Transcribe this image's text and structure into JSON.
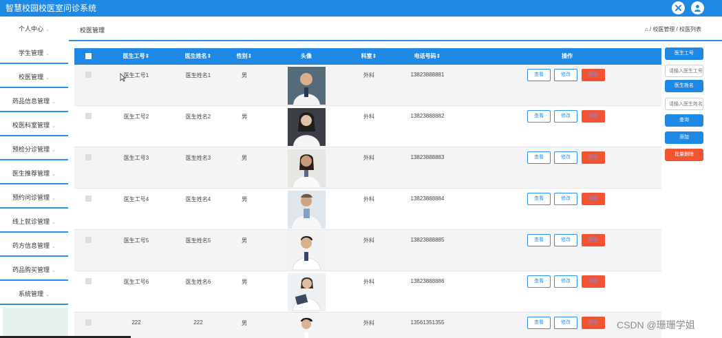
{
  "app": {
    "title": "智慧校园校医室问诊系统"
  },
  "colors": {
    "primary": "#1e88e5",
    "danger": "#f4532f",
    "sidebar_bottom": "#e6f2ec"
  },
  "topbar_icons": [
    "close-circle-icon",
    "user-icon"
  ],
  "sidebar": {
    "user_label": "个人中心",
    "items": [
      {
        "label": "学生管理"
      },
      {
        "label": "校医管理"
      },
      {
        "label": "药品信息管理"
      },
      {
        "label": "校医科室管理"
      },
      {
        "label": "预检分诊管理"
      },
      {
        "label": "医生推荐管理"
      },
      {
        "label": "预约问诊管理"
      },
      {
        "label": "线上就诊管理"
      },
      {
        "label": "药方信息管理"
      },
      {
        "label": "药品购买管理"
      },
      {
        "label": "系统管理"
      }
    ],
    "chevron": "⌄"
  },
  "breadcrumb": {
    "title": "校医管理",
    "path": "⌂ / 校医管理 / 校医列表"
  },
  "table": {
    "columns": [
      "医生工号⇕",
      "医生姓名⇕",
      "性别⇕",
      "头像",
      "科室⇕",
      "电话号码⇕",
      "操作"
    ],
    "rows": [
      {
        "id": "医生工号1",
        "name": "医生姓名1",
        "gender": "男",
        "dept": "外科",
        "phone": "13823888881",
        "avatar": "doctor-photo-icon"
      },
      {
        "id": "医生工号2",
        "name": "医生姓名2",
        "gender": "男",
        "dept": "外科",
        "phone": "13823888882",
        "avatar": "doctor-photo-icon"
      },
      {
        "id": "医生工号3",
        "name": "医生姓名3",
        "gender": "男",
        "dept": "外科",
        "phone": "13823888883",
        "avatar": "doctor-photo-icon"
      },
      {
        "id": "医生工号4",
        "name": "医生姓名4",
        "gender": "男",
        "dept": "外科",
        "phone": "13823888884",
        "avatar": "doctor-photo-icon"
      },
      {
        "id": "医生工号5",
        "name": "医生姓名5",
        "gender": "男",
        "dept": "外科",
        "phone": "13823888885",
        "avatar": "doctor-photo-icon"
      },
      {
        "id": "医生工号6",
        "name": "医生姓名6",
        "gender": "男",
        "dept": "外科",
        "phone": "13823888886",
        "avatar": "doctor-photo-icon"
      },
      {
        "id": "222",
        "name": "222",
        "gender": "男",
        "dept": "外科",
        "phone": "13561351355",
        "avatar": "doctor-photo-icon"
      }
    ],
    "actions": {
      "view": "查看",
      "edit": "修改",
      "delete": "删除"
    }
  },
  "search_panel": {
    "id_label": "医生工号",
    "id_placeholder": "请输入医生工号",
    "name_label": "医生姓名",
    "name_placeholder": "请输入医生姓名",
    "query": "查询",
    "add": "添加",
    "batch_delete": "批量删除"
  },
  "watermark": "CSDN @珊珊学姐"
}
